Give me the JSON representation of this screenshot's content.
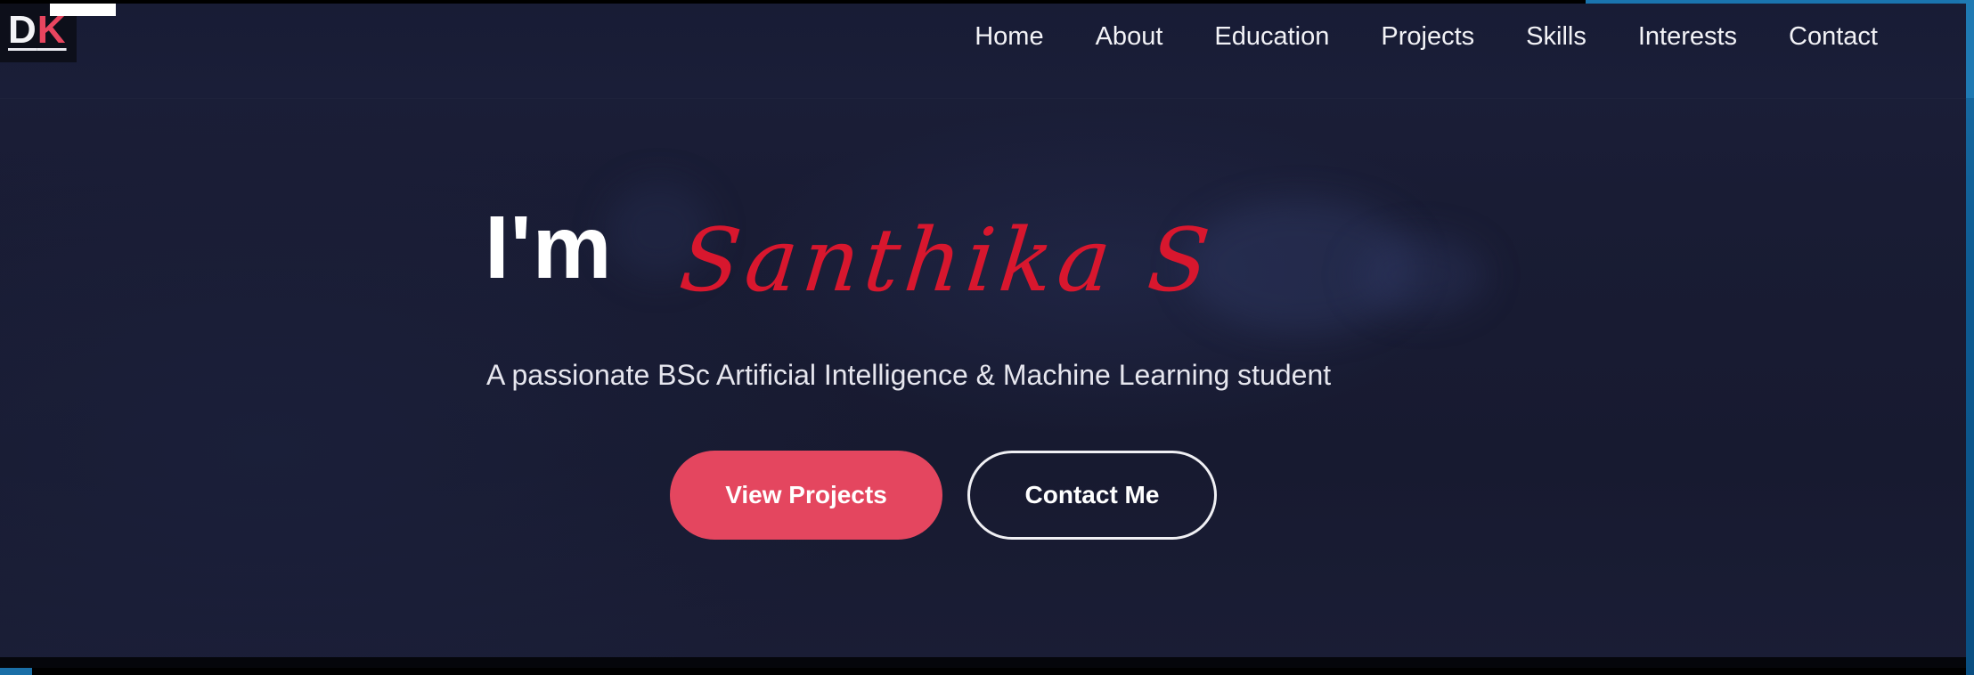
{
  "logo": {
    "letter1": "D",
    "letter2": "K",
    "accent_color": "#e8455f"
  },
  "nav": {
    "items": [
      {
        "label": "Home"
      },
      {
        "label": "About"
      },
      {
        "label": "Education"
      },
      {
        "label": "Projects"
      },
      {
        "label": "Skills"
      },
      {
        "label": "Interests"
      },
      {
        "label": "Contact"
      }
    ]
  },
  "hero": {
    "intro": "I'm",
    "name": "Santhika S",
    "subtitle": "A passionate BSc Artificial Intelligence & Machine Learning student",
    "primary_button": "View Projects",
    "secondary_button": "Contact Me"
  },
  "colors": {
    "background": "#191c34",
    "accent": "#e4465f",
    "name_color": "#d8172e"
  }
}
